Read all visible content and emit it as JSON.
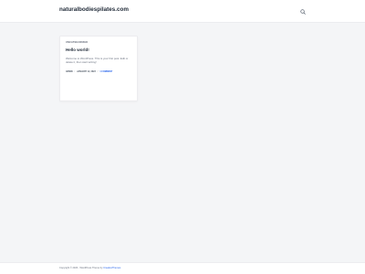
{
  "header": {
    "site_title": "naturalbodiespilates.com",
    "search_icon": "search-icon"
  },
  "post": {
    "category": "UNCATEGORIZED",
    "title": "Hello world!",
    "excerpt": "Welcome to WordPress. This is your first post. Edit or delete it, then start writing!",
    "author": "ADMIN",
    "date": "JANUARY 12, 2023",
    "comments": "1 COMMENT"
  },
  "footer": {
    "copyright": "Copyright © 2023 - WordPress Theme by",
    "theme_author": "CreativeThemes"
  },
  "colors": {
    "background": "#f4f5f7",
    "accent": "#2563eb",
    "text_dark": "#1f2937"
  }
}
